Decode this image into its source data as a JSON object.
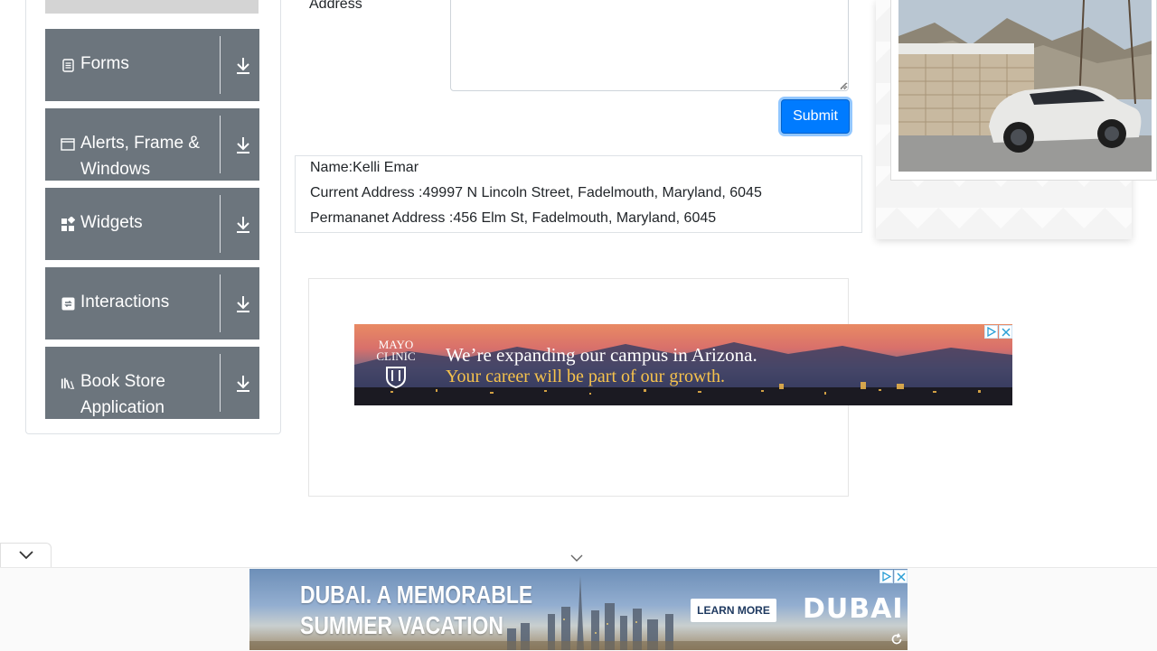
{
  "sidebar": {
    "items": [
      {
        "label": "Forms",
        "icon": "form-icon"
      },
      {
        "label": "Alerts, Frame & Windows",
        "icon": "window-icon"
      },
      {
        "label": "Widgets",
        "icon": "widgets-icon"
      },
      {
        "label": "Interactions",
        "icon": "interactions-icon"
      },
      {
        "label": "Book Store Application",
        "icon": "books-icon"
      }
    ]
  },
  "form": {
    "address_label": "Address",
    "submit_label": "Submit"
  },
  "output": {
    "name": "Name:Kelli Emar",
    "current_address": "Current Address :49997 N Lincoln Street, Fadelmouth, Maryland, 6045",
    "permanent_address": "Permananet Address :456 Elm St, Fadelmouth, Maryland, 6045"
  },
  "ads": {
    "mayo": {
      "logo": "MAYO CLINIC",
      "headline": "We’re expanding our campus in Arizona.",
      "subline": "Your career will be part of our growth."
    },
    "dubai": {
      "headline_line1": "DUBAI. A MEMORABLE",
      "headline_line2": "SUMMER VACATION",
      "cta": "LEARN MORE",
      "logo": "DUBAI"
    }
  },
  "colors": {
    "sidebar_item_bg": "#6c757d",
    "submit_bg": "#007bff",
    "mayo_subline": "#f6c24c"
  }
}
